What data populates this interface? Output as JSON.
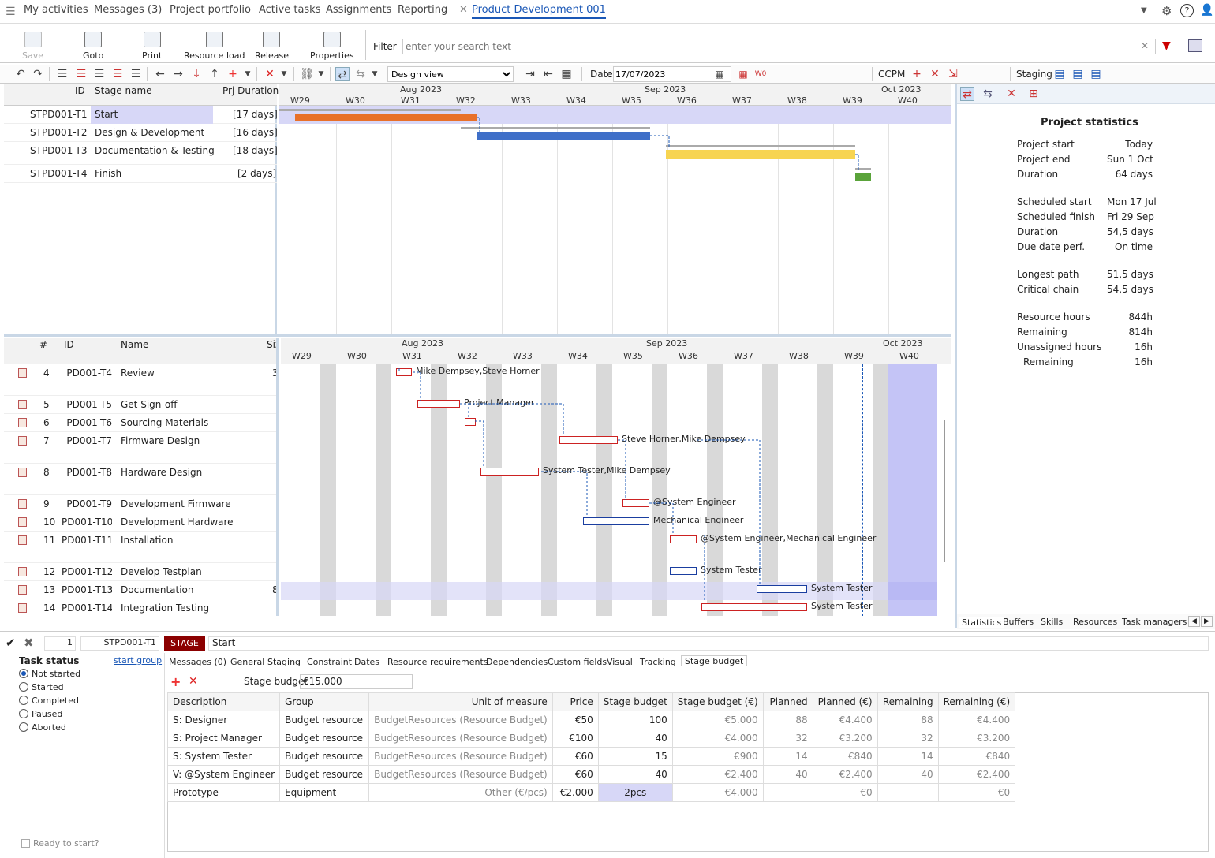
{
  "nav": {
    "items": [
      "My activities",
      "Messages (3)",
      "Project portfolio",
      "Active tasks",
      "Assignments",
      "Reporting"
    ],
    "active_tab": "Product Development 001"
  },
  "toolbar": {
    "buttons": [
      "Save",
      "Goto",
      "Print",
      "Resource load",
      "Release",
      "Properties"
    ],
    "filter_label": "Filter",
    "filter_placeholder": "enter your search text"
  },
  "iconbar": {
    "view": "Design view",
    "date_label": "Date",
    "date_value": "17/07/2023",
    "ccpm_label": "CCPM",
    "staging_label": "Staging"
  },
  "stage_grid": {
    "headers": [
      "ID",
      "Stage name",
      "Prj Duration"
    ],
    "rows": [
      {
        "id": "STPD001-T1",
        "name": "Start",
        "dur": "[17 days]"
      },
      {
        "id": "STPD001-T2",
        "name": "Design & Development",
        "dur": "[16 days]"
      },
      {
        "id": "STPD001-T3",
        "name": "Documentation & Testing",
        "dur": "[18 days]"
      },
      {
        "id": "STPD001-T4",
        "name": "Finish",
        "dur": "[2 days]"
      }
    ]
  },
  "timeline": {
    "months": [
      "Aug 2023",
      "Sep 2023",
      "Oct 2023"
    ],
    "weeks": [
      "W29",
      "W30",
      "W31",
      "W32",
      "W33",
      "W34",
      "W35",
      "W36",
      "W37",
      "W38",
      "W39",
      "W40",
      "W"
    ]
  },
  "task_grid": {
    "headers": [
      "#",
      "ID",
      "Name",
      "Siz"
    ],
    "rows": [
      {
        "n": "4",
        "id": "PD001-T4",
        "name": "Review",
        "size": "3",
        "res": "Mike Dempsey,Steve Horner"
      },
      {
        "n": "5",
        "id": "PD001-T5",
        "name": "Get Sign-off",
        "size": "",
        "res": "Project Manager"
      },
      {
        "n": "6",
        "id": "PD001-T6",
        "name": "Sourcing Materials",
        "size": "",
        "res": ""
      },
      {
        "n": "7",
        "id": "PD001-T7",
        "name": "Firmware Design",
        "size": "",
        "res": "Steve Horner,Mike Dempsey"
      },
      {
        "n": "8",
        "id": "PD001-T8",
        "name": "Hardware Design",
        "size": "",
        "res": "System Tester,Mike Dempsey"
      },
      {
        "n": "9",
        "id": "PD001-T9",
        "name": "Development Firmware",
        "size": "",
        "res": "@System Engineer"
      },
      {
        "n": "10",
        "id": "PD001-T10",
        "name": "Development Hardware",
        "size": "",
        "res": "Mechanical Engineer"
      },
      {
        "n": "11",
        "id": "PD001-T11",
        "name": "Installation",
        "size": "",
        "res": "@System Engineer,Mechanical Engineer"
      },
      {
        "n": "12",
        "id": "PD001-T12",
        "name": "Develop Testplan",
        "size": "",
        "res": "System Tester"
      },
      {
        "n": "13",
        "id": "PD001-T13",
        "name": "Documentation",
        "size": "8",
        "res": "System Tester"
      },
      {
        "n": "14",
        "id": "PD001-T14",
        "name": "Integration Testing",
        "size": "",
        "res": "System Tester"
      }
    ]
  },
  "stats": {
    "title": "Project statistics",
    "rows": [
      [
        "Project start",
        "Today"
      ],
      [
        "Project end",
        "Sun 1 Oct"
      ],
      [
        "Duration",
        "64 days"
      ],
      [
        "Scheduled start",
        "Mon 17 Jul"
      ],
      [
        "Scheduled finish",
        "Fri 29 Sep"
      ],
      [
        "Duration",
        "54,5 days"
      ],
      [
        "Due date perf.",
        "On time"
      ],
      [
        "Longest path",
        "51,5 days"
      ],
      [
        "Critical chain",
        "54,5 days"
      ],
      [
        "Resource hours",
        "844h"
      ],
      [
        "Remaining",
        "814h"
      ],
      [
        "Unassigned hours",
        "16h"
      ],
      [
        "Remaining",
        "16h"
      ]
    ],
    "tabs": [
      "Statistics",
      "Buffers",
      "Skills",
      "Resources",
      "Task managers"
    ]
  },
  "detail": {
    "num": "1",
    "id": "STPD001-T1",
    "type": "STAGE",
    "name": "Start",
    "task_status_label": "Task status",
    "start_group": "start group",
    "statuses": [
      "Not started",
      "Started",
      "Completed",
      "Paused",
      "Aborted"
    ],
    "ready_label": "Ready to start?",
    "tabs": [
      "Messages (0)",
      "General",
      "Staging",
      "Constraint",
      "Dates",
      "Resource requirements",
      "Dependencies",
      "Custom fields",
      "Visual",
      "Tracking",
      "Stage budget"
    ],
    "budget_label": "Stage budget",
    "budget_value": "€15.000",
    "budget_headers": [
      "Description",
      "Group",
      "Unit of measure",
      "Price",
      "Stage budget",
      "Stage budget (€)",
      "Planned",
      "Planned (€)",
      "Remaining",
      "Remaining (€)"
    ],
    "budget_rows": [
      [
        "S: Designer",
        "Budget resource",
        "BudgetResources (Resource Budget)",
        "€50",
        "100",
        "€5.000",
        "88",
        "€4.400",
        "88",
        "€4.400"
      ],
      [
        "S: Project Manager",
        "Budget resource",
        "BudgetResources (Resource Budget)",
        "€100",
        "40",
        "€4.000",
        "32",
        "€3.200",
        "32",
        "€3.200"
      ],
      [
        "S: System Tester",
        "Budget resource",
        "BudgetResources (Resource Budget)",
        "€60",
        "15",
        "€900",
        "14",
        "€840",
        "14",
        "€840"
      ],
      [
        "V: @System Engineer",
        "Budget resource",
        "BudgetResources (Resource Budget)",
        "€60",
        "40",
        "€2.400",
        "40",
        "€2.400",
        "40",
        "€2.400"
      ],
      [
        "Prototype",
        "Equipment",
        "Other (€/pcs)",
        "€2.000",
        "2pcs",
        "€4.000",
        "",
        "€0",
        "",
        "€0"
      ]
    ]
  },
  "colors": {
    "accent": "#1a57b6",
    "stage_red": "#8b0000",
    "start_bar": "#e8702a",
    "design_bar": "#3f6fc8",
    "doc_bar": "#f7d451",
    "finish_bar": "#5aa33a",
    "highlight": "#d7d7f7"
  }
}
